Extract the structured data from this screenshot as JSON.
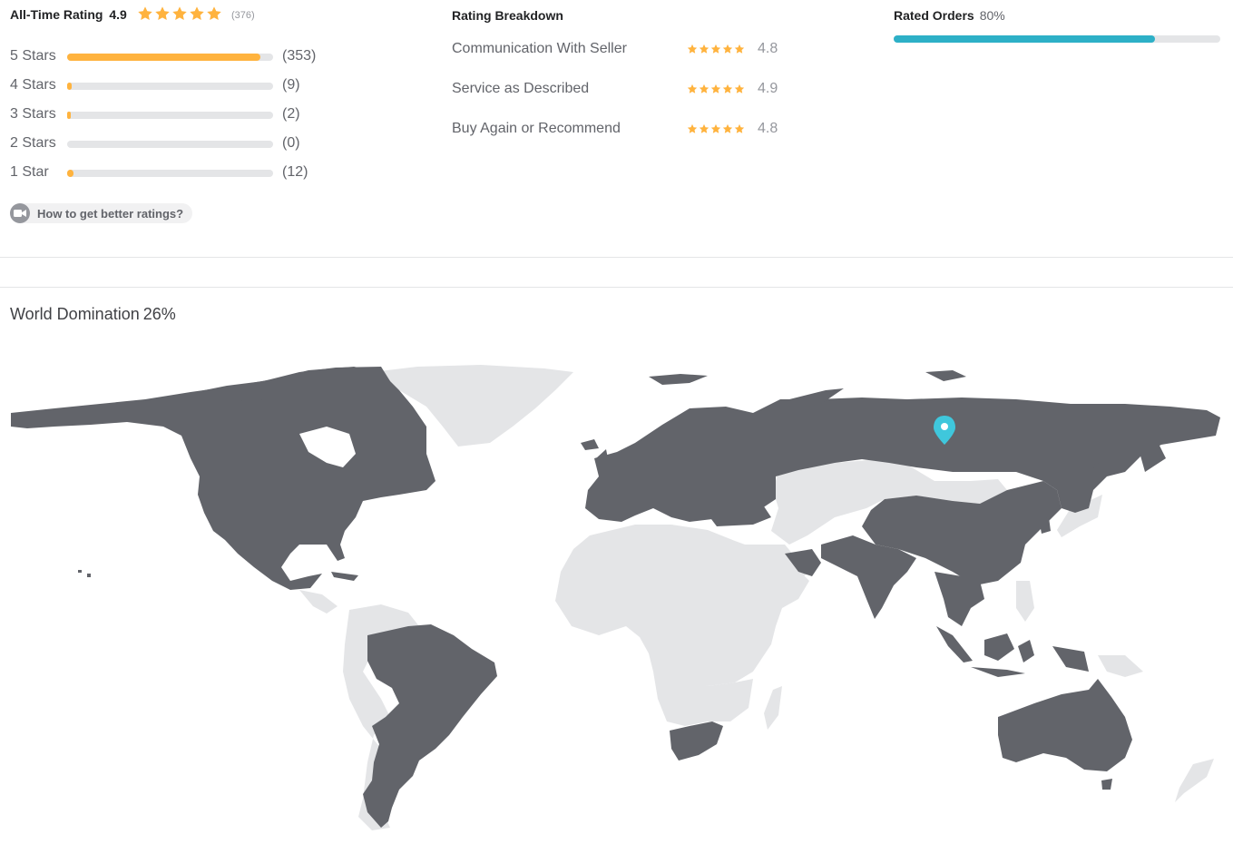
{
  "rating": {
    "title": "All-Time Rating",
    "value": "4.9",
    "count": "(376)",
    "stars_filled": 5,
    "distribution": [
      {
        "label": "5 Stars",
        "count": "(353)",
        "fraction": 0.94
      },
      {
        "label": "4 Stars",
        "count": "(9)",
        "fraction": 0.024
      },
      {
        "label": "3 Stars",
        "count": "(2)",
        "fraction": 0.005
      },
      {
        "label": "2 Stars",
        "count": "(0)",
        "fraction": 0.0
      },
      {
        "label": "1 Star",
        "count": "(12)",
        "fraction": 0.032
      }
    ],
    "help_link": "How to get better ratings?"
  },
  "breakdown": {
    "title": "Rating Breakdown",
    "items": [
      {
        "label": "Communication With Seller",
        "score": "4.8"
      },
      {
        "label": "Service as Described",
        "score": "4.9"
      },
      {
        "label": "Buy Again or Recommend",
        "score": "4.8"
      }
    ]
  },
  "orders": {
    "title": "Rated Orders",
    "percent_label": "80%",
    "fraction": 0.8
  },
  "domination": {
    "title": "World Domination",
    "percent_label": "26%"
  },
  "colors": {
    "star": "#ffb33e",
    "bar_fill": "#ffb33e",
    "bar_track": "#e4e5e7",
    "orders_fill": "#2db0c7",
    "map_active": "#62646a",
    "map_inactive": "#e4e5e7",
    "map_pin": "#3fc7dc"
  },
  "icons": {
    "star": "star-icon",
    "video": "video-camera-icon",
    "pin": "map-pin-icon"
  }
}
